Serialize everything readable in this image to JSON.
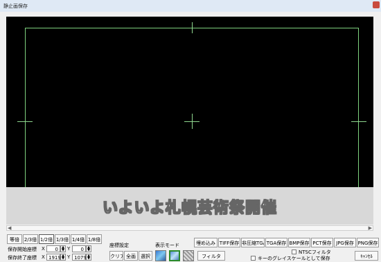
{
  "window": {
    "title": "静止画保存"
  },
  "preview": {
    "caption": "いよいよ札幌芸術祭開催"
  },
  "zoom_buttons": [
    "等倍",
    "2/3倍",
    "1/2倍",
    "1/3倍",
    "1/4倍",
    "1/8倍"
  ],
  "zoom_selected": "1/2倍",
  "coords": {
    "start_label": "保存開始座標",
    "end_label": "保存終了座標",
    "x_label": "X",
    "y_label": "Y",
    "start_x": "0",
    "start_y": "0",
    "end_x": "1919",
    "end_y": "1079"
  },
  "coord_settings": {
    "label": "座標設定",
    "clear": "クリア",
    "all": "全画",
    "select": "選択"
  },
  "display_mode": {
    "label": "表示モード",
    "filter": "フィルタ"
  },
  "save_buttons": [
    "埋め込み",
    "TIFF保存",
    "非圧縮TGA",
    "TGA保存",
    "BMP保存",
    "PCT保存",
    "JPG保存",
    "PNG保存"
  ],
  "options": {
    "ntsc_filter": "NTSCフィルタ",
    "grayscale_key": "キーのグレイスケールとして保存"
  },
  "cancel": "ｷｬﾝｾﾙ"
}
